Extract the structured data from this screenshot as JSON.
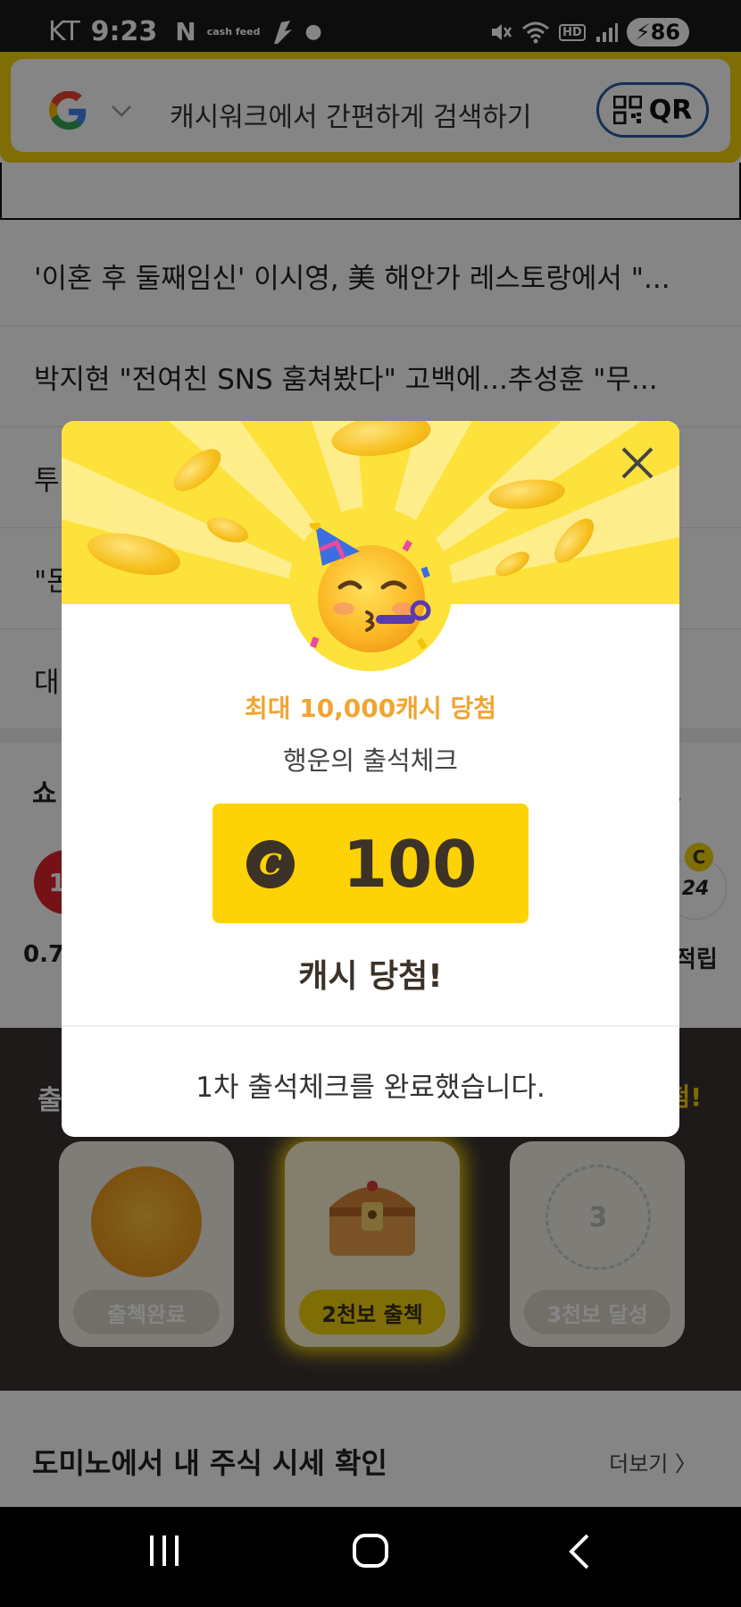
{
  "status_bar": {
    "carrier": "KT",
    "time": "9:23",
    "notif_n": "N",
    "notif_cash": "cash feed",
    "battery": "86",
    "hd": "HD"
  },
  "search": {
    "placeholder": "캐시워크에서 간편하게 검색하기",
    "qr_label": "QR"
  },
  "news": [
    "'이혼 후 둘째임신' 이시영, 美 해안가 레스토랑에서 \"...",
    "박지현 \"전여친 SNS 훔쳐봤다\" 고백에...추성훈 \"무...",
    "투",
    "\"돈",
    "대"
  ],
  "shopping": {
    "title_partial": "쇼",
    "left_logo": "11",
    "left_value": "0.7",
    "right_badge": "C",
    "right_logo": "24",
    "right_label": "적립"
  },
  "attendance": {
    "title_partial": "출",
    "right_partial": "첨!",
    "cards": [
      {
        "label": "출첵완료",
        "state": "done"
      },
      {
        "label": "2천보 출첵",
        "state": "active"
      },
      {
        "label": "3천보 달성",
        "state": "locked",
        "number": "3"
      }
    ]
  },
  "bottom": {
    "title": "도미노에서 내 주식 시세 확인",
    "more": "더보기 〉"
  },
  "modal": {
    "subtitle": "최대 10,000캐시 당첨",
    "description": "행운의 출석체크",
    "cash_amount": "100",
    "cash_icon_letter": "C",
    "win_text": "캐시 당첨!",
    "footer": "1차 출석체크를 완료했습니다."
  },
  "colors": {
    "brand_yellow": "#fed305",
    "accent_orange": "#f0a533",
    "dark_brown": "#3d3228"
  }
}
